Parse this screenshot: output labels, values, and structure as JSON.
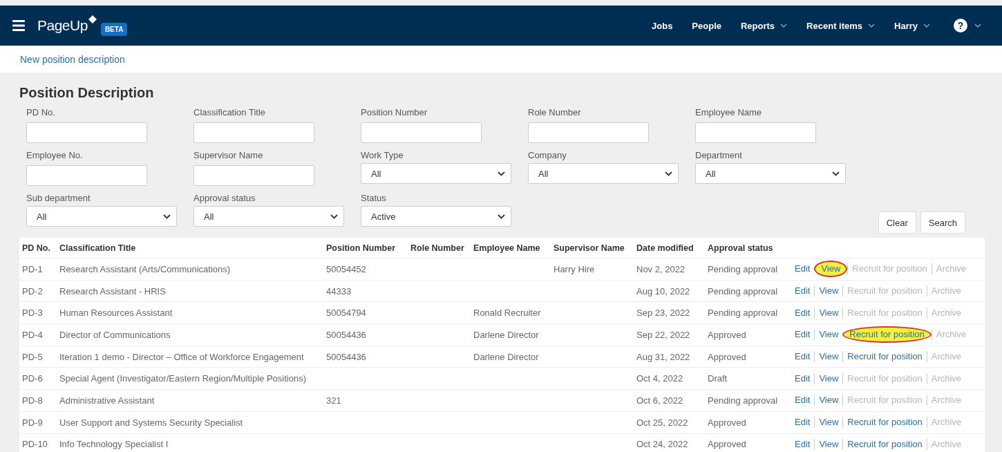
{
  "nav": {
    "logo": "PageUp",
    "badge": "BETA",
    "items": [
      {
        "label": "Jobs",
        "dropdown": false
      },
      {
        "label": "People",
        "dropdown": false
      },
      {
        "label": "Reports",
        "dropdown": true
      },
      {
        "label": "Recent items",
        "dropdown": true
      },
      {
        "label": "Harry",
        "dropdown": true
      }
    ],
    "help": "?",
    "help_dropdown": true
  },
  "subbar": {
    "link": "New position description"
  },
  "page_title": "Position Description",
  "filter_rows": [
    [
      {
        "label": "PD No.",
        "kind": "text"
      },
      {
        "label": "Classification Title",
        "kind": "text"
      },
      {
        "label": "Position Number",
        "kind": "text"
      },
      {
        "label": "Role Number",
        "kind": "text"
      },
      {
        "label": "Employee Name",
        "kind": "text"
      }
    ],
    [
      {
        "label": "Employee No.",
        "kind": "text"
      },
      {
        "label": "Supervisor Name",
        "kind": "text"
      },
      {
        "label": "Work Type",
        "kind": "select",
        "value": "All"
      },
      {
        "label": "Company",
        "kind": "select",
        "value": "All"
      },
      {
        "label": "Department",
        "kind": "select",
        "value": "All"
      }
    ],
    [
      {
        "label": "Sub department",
        "kind": "select",
        "value": "All"
      },
      {
        "label": "Approval status",
        "kind": "select",
        "value": "All"
      },
      {
        "label": "Status",
        "kind": "select",
        "value": "Active"
      }
    ]
  ],
  "buttons": [
    "Clear",
    "Search"
  ],
  "table": {
    "columns": [
      "PD No.",
      "Classification Title",
      "Position Number",
      "Role Number",
      "Employee Name",
      "Supervisor Name",
      "Date modified",
      "Approval status"
    ],
    "rows": [
      {
        "cells": [
          "PD-1",
          "Research Assistant (Arts/Communications)",
          "50054452",
          "",
          "",
          "Harry Hire",
          "Nov 2, 2022",
          "Pending approval"
        ],
        "actions": [
          {
            "label": "Edit",
            "disabled": false,
            "highlighted": false
          },
          {
            "label": "View",
            "disabled": false,
            "highlighted": true
          },
          {
            "label": "Recruit for position",
            "disabled": true,
            "highlighted": false
          },
          {
            "label": "Archive",
            "disabled": true,
            "highlighted": false
          }
        ]
      },
      {
        "cells": [
          "PD-2",
          "Research Assistant - HRIS",
          "44333",
          "",
          "",
          "",
          "Aug 10, 2022",
          "Pending approval"
        ],
        "actions": [
          {
            "label": "Edit",
            "disabled": false,
            "highlighted": false
          },
          {
            "label": "View",
            "disabled": false,
            "highlighted": false
          },
          {
            "label": "Recruit for position",
            "disabled": true,
            "highlighted": false
          },
          {
            "label": "Archive",
            "disabled": true,
            "highlighted": false
          }
        ]
      },
      {
        "cells": [
          "PD-3",
          "Human Resources Assistant",
          "50054794",
          "",
          "Ronald Recruiter",
          "",
          "Sep 23, 2022",
          "Pending approval"
        ],
        "actions": [
          {
            "label": "Edit",
            "disabled": false,
            "highlighted": false
          },
          {
            "label": "View",
            "disabled": false,
            "highlighted": false
          },
          {
            "label": "Recruit for position",
            "disabled": true,
            "highlighted": false
          },
          {
            "label": "Archive",
            "disabled": true,
            "highlighted": false
          }
        ]
      },
      {
        "cells": [
          "PD-4",
          "Director of Communications",
          "50054436",
          "",
          "Darlene Director",
          "",
          "Sep 22, 2022",
          "Approved"
        ],
        "actions": [
          {
            "label": "Edit",
            "disabled": false,
            "highlighted": false
          },
          {
            "label": "View",
            "disabled": false,
            "highlighted": false
          },
          {
            "label": "Recruit for position",
            "disabled": false,
            "highlighted": true
          },
          {
            "label": "Archive",
            "disabled": true,
            "highlighted": false
          }
        ]
      },
      {
        "cells": [
          "PD-5",
          "Iteration 1 demo - Director – Office of Workforce Engagement",
          "50054436",
          "",
          "Darlene Director",
          "",
          "Aug 31, 2022",
          "Approved"
        ],
        "actions": [
          {
            "label": "Edit",
            "disabled": false,
            "highlighted": false
          },
          {
            "label": "View",
            "disabled": false,
            "highlighted": false
          },
          {
            "label": "Recruit for position",
            "disabled": false,
            "highlighted": false
          },
          {
            "label": "Archive",
            "disabled": true,
            "highlighted": false
          }
        ]
      },
      {
        "cells": [
          "PD-6",
          "Special Agent (Investigator/Eastern Region/Multiple Positions)",
          "",
          "",
          "",
          "",
          "Oct 4, 2022",
          "Draft"
        ],
        "actions": [
          {
            "label": "Edit",
            "disabled": false,
            "highlighted": false
          },
          {
            "label": "View",
            "disabled": false,
            "highlighted": false
          },
          {
            "label": "Recruit for position",
            "disabled": true,
            "highlighted": false
          },
          {
            "label": "Archive",
            "disabled": true,
            "highlighted": false
          }
        ]
      },
      {
        "cells": [
          "PD-8",
          "Administrative Assistant",
          "321",
          "",
          "",
          "",
          "Oct 6, 2022",
          "Pending approval"
        ],
        "actions": [
          {
            "label": "Edit",
            "disabled": false,
            "highlighted": false
          },
          {
            "label": "View",
            "disabled": false,
            "highlighted": false
          },
          {
            "label": "Recruit for position",
            "disabled": true,
            "highlighted": false
          },
          {
            "label": "Archive",
            "disabled": true,
            "highlighted": false
          }
        ]
      },
      {
        "cells": [
          "PD-9",
          "User Support and Systems Security Specialist",
          "",
          "",
          "",
          "",
          "Oct 25, 2022",
          "Approved"
        ],
        "actions": [
          {
            "label": "Edit",
            "disabled": false,
            "highlighted": false
          },
          {
            "label": "View",
            "disabled": false,
            "highlighted": false
          },
          {
            "label": "Recruit for position",
            "disabled": false,
            "highlighted": false
          },
          {
            "label": "Archive",
            "disabled": true,
            "highlighted": false
          }
        ]
      },
      {
        "cells": [
          "PD-10",
          "Info Technology Specialist I",
          "",
          "",
          "",
          "",
          "Oct 24, 2022",
          "Approved"
        ],
        "actions": [
          {
            "label": "Edit",
            "disabled": false,
            "highlighted": false
          },
          {
            "label": "View",
            "disabled": false,
            "highlighted": false
          },
          {
            "label": "Recruit for position",
            "disabled": false,
            "highlighted": false
          },
          {
            "label": "Archive",
            "disabled": true,
            "highlighted": false
          }
        ]
      }
    ]
  }
}
